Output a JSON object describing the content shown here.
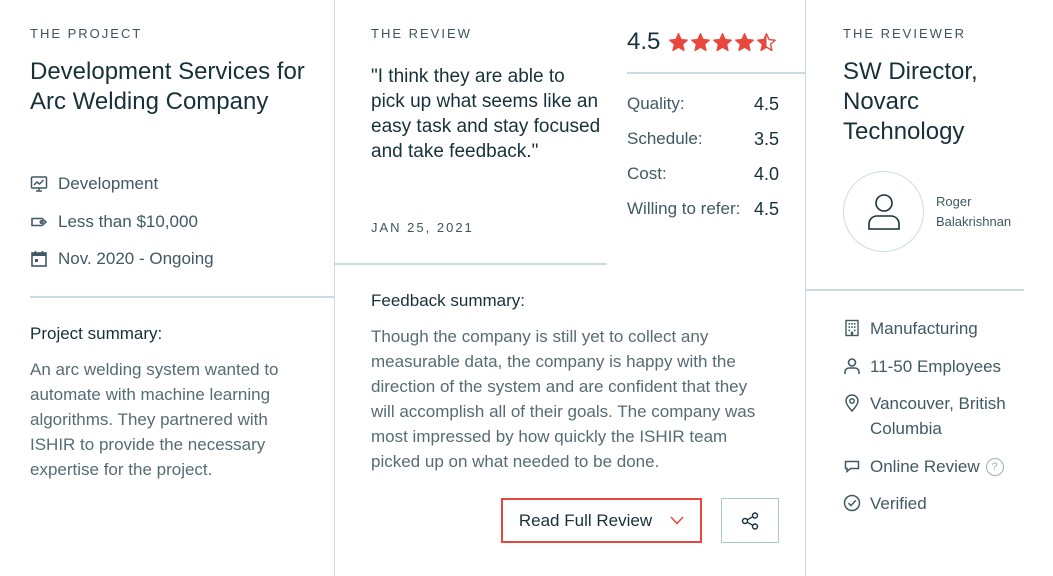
{
  "project": {
    "eyebrow": "THE PROJECT",
    "title": "Development Services for Arc Welding Company",
    "service": "Development",
    "budget": "Less than $10,000",
    "timeline": "Nov. 2020 - Ongoing",
    "summary_heading": "Project summary:",
    "summary_text": "An arc welding system wanted to automate with machine learning algorithms. They partnered with ISHIR to provide the necessary expertise for the project."
  },
  "review": {
    "eyebrow": "THE REVIEW",
    "quote": "\"I think they are able to pick up what seems like an easy task and stay focused and take feedback.\"",
    "date": "JAN 25, 2021",
    "overall": "4.5",
    "overall_value": 4.5,
    "scores": [
      {
        "label": "Quality:",
        "value": "4.5"
      },
      {
        "label": "Schedule:",
        "value": "3.5"
      },
      {
        "label": "Cost:",
        "value": "4.0"
      },
      {
        "label": "Willing to refer:",
        "value": "4.5"
      }
    ],
    "feedback_heading": "Feedback summary:",
    "feedback_text": "Though the company is still yet to collect any measurable data, the company is happy with the direction of the system and are confident that they will accomplish all of their goals. The company was most impressed by how quickly the ISHIR team picked up on what needed to be done.",
    "read_full_label": "Read Full Review"
  },
  "reviewer": {
    "eyebrow": "THE REVIEWER",
    "title": "SW Director, Novarc Technology",
    "name": "Roger Balakrishnan",
    "industry": "Manufacturing",
    "size": "11-50 Employees",
    "location": "Vancouver, British Columbia",
    "review_type": "Online Review",
    "help_glyph": "?",
    "verified": "Verified"
  },
  "colors": {
    "star": "#e8473e",
    "divider": "#c9dce4",
    "text_dark": "#17313b",
    "text_muted": "#566c75"
  }
}
